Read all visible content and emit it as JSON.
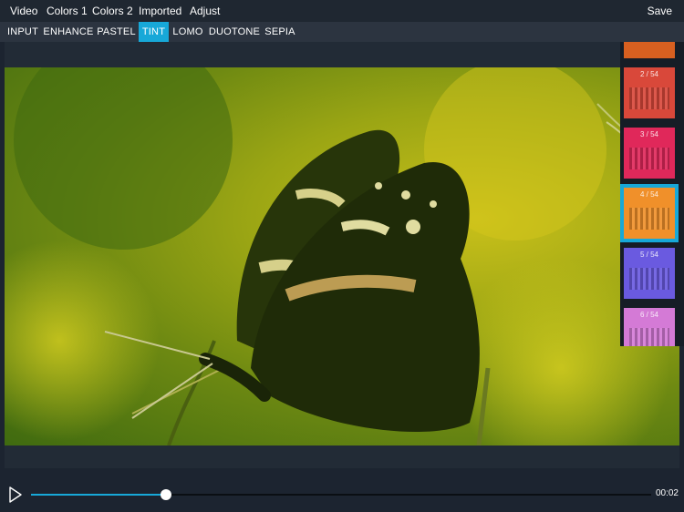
{
  "top_menu": {
    "items": [
      "Video",
      "Colors 1",
      "Colors 2",
      "Imported",
      "Adjust"
    ],
    "save_label": "Save"
  },
  "filter_tabs": {
    "items": [
      "INPUT",
      "ENHANCE",
      "PASTEL",
      "TINT",
      "LOMO",
      "DUOTONE",
      "SEPIA"
    ],
    "active": "TINT"
  },
  "thumbnails": [
    {
      "label": "2 / 54",
      "color": "#d9483a"
    },
    {
      "label": "3 / 54",
      "color": "#e0285a"
    },
    {
      "label": "4 / 54",
      "color": "#f0902a"
    },
    {
      "label": "5 / 54",
      "color": "#6a5ae0"
    },
    {
      "label": "6 / 54",
      "color": "#d47ad6"
    }
  ],
  "selected_thumbnail": "4 / 54",
  "player": {
    "time": "00:02",
    "progress": 0.217
  },
  "colors": {
    "accent": "#17a8d8",
    "topbar": "#1f2731",
    "tabbar": "#2c3440",
    "background": "#1c2430"
  }
}
